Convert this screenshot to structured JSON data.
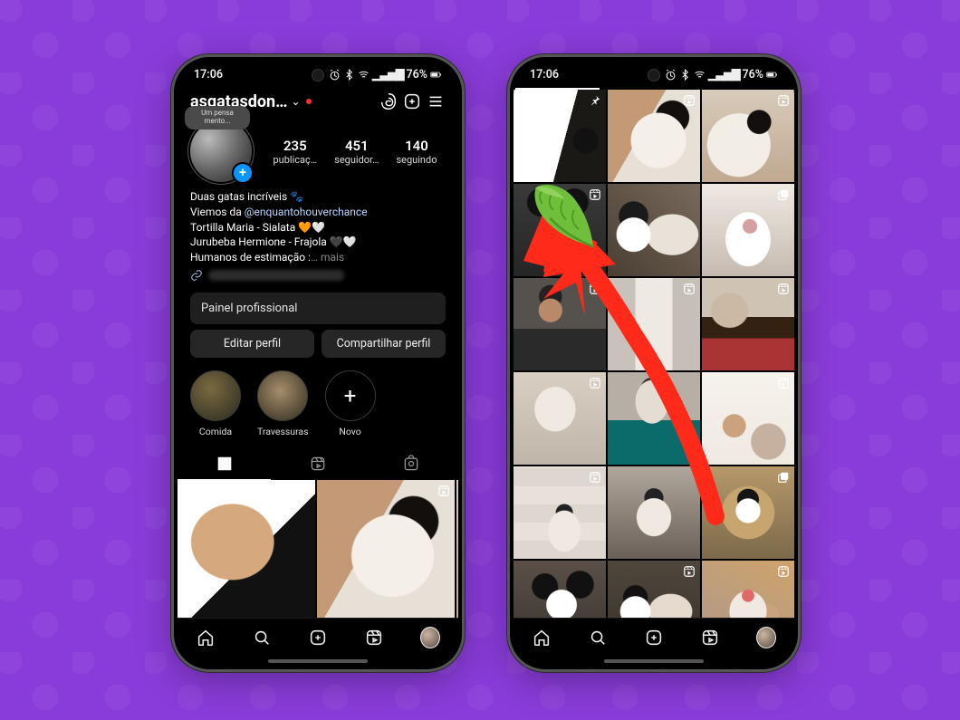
{
  "status_bar": {
    "time": "17:06",
    "battery_pct": "76%"
  },
  "profile": {
    "username_display": "asgatasdon…",
    "note_bubble": "Um pensa\nmento...",
    "stats": {
      "posts": {
        "value": "235",
        "label": "publicaç…"
      },
      "followers": {
        "value": "451",
        "label": "seguidor…"
      },
      "following": {
        "value": "140",
        "label": "seguindo"
      }
    },
    "bio": {
      "line1": "Duas gatas incríveis 🐾",
      "line2_prefix": "Viemos da ",
      "line2_mention": "@enquantohouverchance",
      "line3": "Tortilla Maria - Sialata 🧡🤍",
      "line4": "Jurubeba Hermione - Frajola 🖤🤍",
      "line5_prefix": "Humanos de estimação :",
      "more": "… mais"
    },
    "pro_panel": "Painel profissional",
    "edit_btn": "Editar perfil",
    "share_btn": "Compartilhar perfil",
    "highlights": [
      {
        "label": "Comida"
      },
      {
        "label": "Travessuras"
      },
      {
        "label": "Novo",
        "is_new": true
      }
    ]
  },
  "profile_grid": [
    {
      "style": "p-hand",
      "badge": "pin"
    },
    {
      "style": "p-belly",
      "badge": "reel"
    },
    {
      "style": "p-close",
      "badge": "reel"
    }
  ],
  "full_grid": [
    {
      "style": "p-sniff",
      "badge": "pin"
    },
    {
      "style": "p-belly",
      "badge": "reel"
    },
    {
      "style": "p-close",
      "badge": "reel"
    },
    {
      "style": "p-bwhead",
      "badge": "reel"
    },
    {
      "style": "p-two",
      "badge": null
    },
    {
      "style": "p-paw",
      "badge": "multi"
    },
    {
      "style": "p-person",
      "badge": "reel"
    },
    {
      "style": "p-door",
      "badge": "reel"
    },
    {
      "style": "p-mat",
      "badge": "reel"
    },
    {
      "style": "p-bed",
      "badge": "reel"
    },
    {
      "style": "p-teal",
      "badge": null
    },
    {
      "style": "p-wall",
      "badge": "reel"
    },
    {
      "style": "p-tile",
      "badge": "reel"
    },
    {
      "style": "p-sofa",
      "badge": null
    },
    {
      "style": "p-box",
      "badge": "multi"
    },
    {
      "style": "p-bw2",
      "badge": null
    },
    {
      "style": "p-twosleep",
      "badge": "reel"
    },
    {
      "style": "p-tongue",
      "badge": "reel"
    }
  ],
  "annotation": {
    "color": "#ff2a1a"
  }
}
